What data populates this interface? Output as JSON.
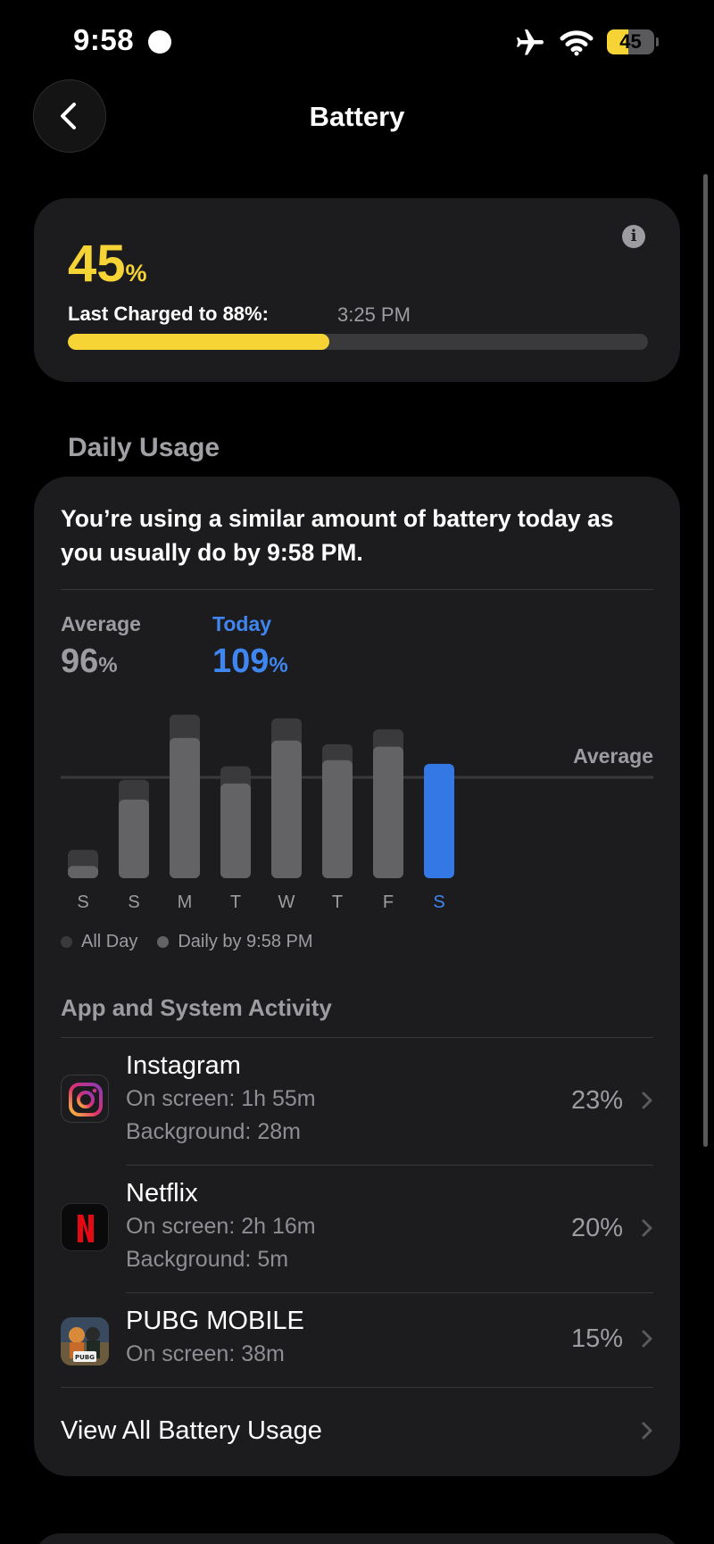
{
  "status_bar": {
    "time": "9:58",
    "battery_level": "45",
    "battery_fraction": 0.45
  },
  "nav": {
    "title": "Battery"
  },
  "level_card": {
    "percent": "45",
    "percent_sign": "%",
    "level_fraction": 0.45,
    "charged_label": "Last Charged to 88%:",
    "charged_time": "3:25 PM"
  },
  "daily_usage": {
    "header": "Daily Usage",
    "insight": "You’re using a similar amount of battery today as you usually do by 9:58 PM.",
    "average_label": "Average",
    "average_value": "96",
    "today_label": "Today",
    "today_value": "109",
    "percent_sign": "%",
    "legend": {
      "all_day": "All Day",
      "daily_by": "Daily by 9:58 PM"
    }
  },
  "chart_data": {
    "type": "bar",
    "categories": [
      "S",
      "S",
      "M",
      "T",
      "W",
      "T",
      "F",
      "S"
    ],
    "series": [
      {
        "name": "All Day",
        "values": [
          23,
          80,
          133,
          91,
          130,
          109,
          121,
          null
        ]
      },
      {
        "name": "Daily by 9:58 PM",
        "values": [
          10,
          64,
          114,
          77,
          112,
          96,
          107,
          93
        ]
      }
    ],
    "highlight_index": 7,
    "reference_line": {
      "label": "Average",
      "value": 82
    },
    "ylim": [
      0,
      135
    ],
    "colors": {
      "all_day": "#3a3a3c",
      "daily": "#636366",
      "today": "#3478e6",
      "today_label": "#3f86f0"
    }
  },
  "activity": {
    "header": "App and System Activity",
    "apps": [
      {
        "name": "Instagram",
        "on_screen": "On screen: 1h 55m",
        "background": "Background: 28m",
        "percent": "23%",
        "icon": "instagram-icon"
      },
      {
        "name": "Netflix",
        "on_screen": "On screen: 2h 16m",
        "background": "Background: 5m",
        "percent": "20%",
        "icon": "netflix-icon"
      },
      {
        "name": "PUBG MOBILE",
        "on_screen": "On screen: 38m",
        "percent": "15%",
        "icon": "pubg-mobile-icon"
      }
    ],
    "view_all": "View All Battery Usage"
  },
  "colors": {
    "accent_yellow": "#f7d435",
    "accent_blue": "#3f86f0",
    "card_bg": "#1c1c1e",
    "secondary_text": "#9c9ca1"
  }
}
